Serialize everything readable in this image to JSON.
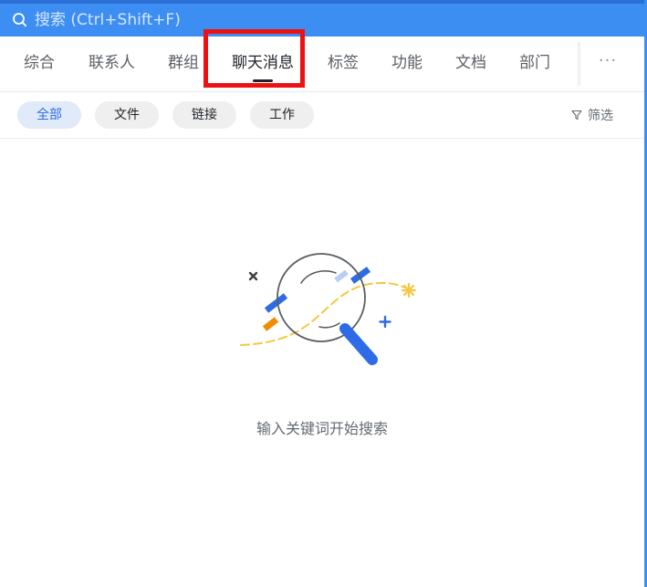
{
  "search": {
    "placeholder": "搜索 (Ctrl+Shift+F)",
    "value": ""
  },
  "tabs": [
    {
      "label": "综合",
      "active": false
    },
    {
      "label": "联系人",
      "active": false
    },
    {
      "label": "群组",
      "active": false
    },
    {
      "label": "聊天消息",
      "active": true
    },
    {
      "label": "标签",
      "active": false
    },
    {
      "label": "功能",
      "active": false
    },
    {
      "label": "文档",
      "active": false
    },
    {
      "label": "部门",
      "active": false
    }
  ],
  "more_label": "···",
  "filters": {
    "chips": [
      {
        "label": "全部",
        "active": true
      },
      {
        "label": "文件",
        "active": false
      },
      {
        "label": "链接",
        "active": false
      },
      {
        "label": "工作",
        "active": false
      }
    ],
    "filter_label": "筛选"
  },
  "empty_state": {
    "message": "输入关键词开始搜索"
  },
  "colors": {
    "search_bar": "#3d8ef3",
    "accent": "#2e6be6",
    "highlight": "#ee1111",
    "illustration_yellow": "#f5c842",
    "illustration_orange": "#f08c00"
  }
}
